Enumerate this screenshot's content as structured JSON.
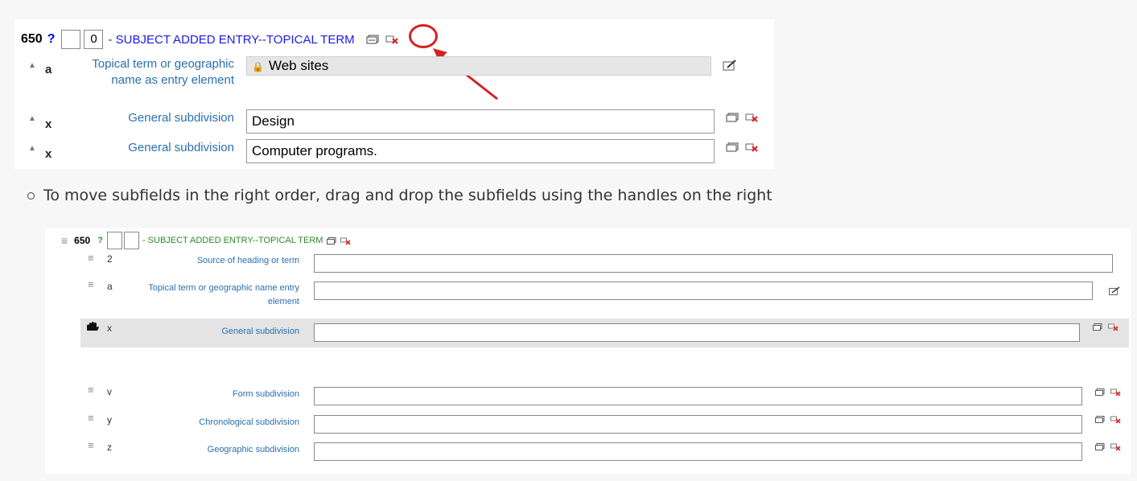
{
  "section1": {
    "tag": "650",
    "help": "?",
    "ind1": "",
    "ind2": "0",
    "title": "- SUBJECT ADDED ENTRY--TOPICAL TERM",
    "rows": [
      {
        "code": "a",
        "label": "Topical term or geographic name as entry element",
        "value": "Web sites",
        "locked": true
      },
      {
        "code": "x",
        "label": "General subdivision",
        "value": "Design"
      },
      {
        "code": "x",
        "label": "General subdivision",
        "value": "Computer programs."
      }
    ],
    "lock_glyph": "🔒"
  },
  "instruction": "To move subfields in the right order, drag and drop the subfields using the handles on the right",
  "section2": {
    "tag": "650",
    "help": "?",
    "title": "- SUBJECT ADDED ENTRY--TOPICAL TERM",
    "rows": [
      {
        "code": "2",
        "label": "Source of heading or term"
      },
      {
        "code": "a",
        "label": "Topical term or geographic name entry element"
      },
      {
        "code": "x",
        "label": "General subdivision",
        "dragging": true
      },
      {
        "code": "v",
        "label": "Form subdivision"
      },
      {
        "code": "y",
        "label": "Chronological subdivision"
      },
      {
        "code": "z",
        "label": "Geographic subdivision"
      }
    ]
  },
  "colors": {
    "link_blue": "#2a6fb0",
    "title_blue": "#1a1aee",
    "title_green": "#2a8a2a",
    "annotation_red": "#d62222"
  },
  "icons": [
    "clone-subfield-icon",
    "delete-subfield-icon",
    "edit-authority-icon",
    "drag-triangle-icon",
    "drag-handle-icon",
    "grab-hand-icon",
    "lock-icon"
  ]
}
